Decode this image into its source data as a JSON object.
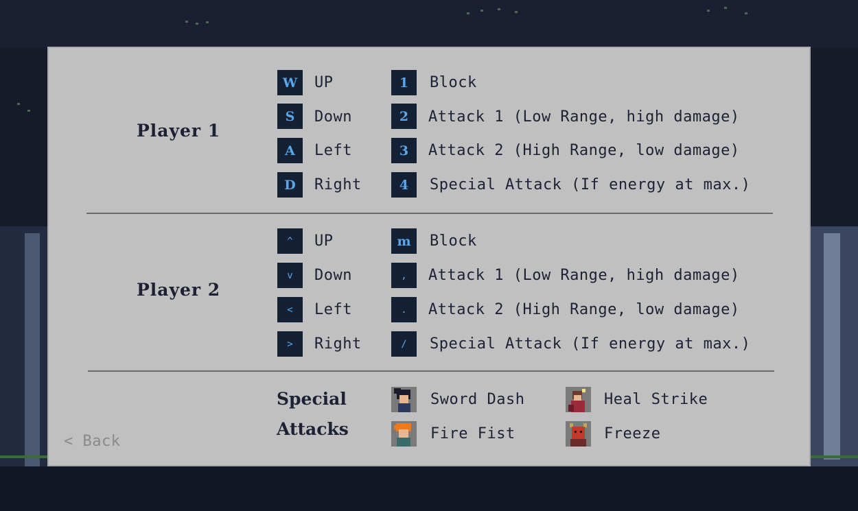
{
  "player1": {
    "title": "Player 1",
    "movement": [
      {
        "key": "W",
        "action": "UP"
      },
      {
        "key": "S",
        "action": "Down"
      },
      {
        "key": "A",
        "action": "Left"
      },
      {
        "key": "D",
        "action": "Right"
      }
    ],
    "combat": [
      {
        "key": "1",
        "action": "Block"
      },
      {
        "key": "2",
        "action": "Attack 1 (Low Range, high damage)"
      },
      {
        "key": "3",
        "action": "Attack 2 (High Range, low damage)"
      },
      {
        "key": "4",
        "action": "Special Attack (If energy at max.)"
      }
    ]
  },
  "player2": {
    "title": "Player 2",
    "movement": [
      {
        "key": "^",
        "action": "UP"
      },
      {
        "key": "v",
        "action": "Down"
      },
      {
        "key": "<",
        "action": "Left"
      },
      {
        "key": ">",
        "action": "Right"
      }
    ],
    "combat": [
      {
        "key": "m",
        "action": "Block"
      },
      {
        "key": ",",
        "action": "Attack 1 (Low Range, high damage)"
      },
      {
        "key": ".",
        "action": "Attack 2 (High Range, low damage)"
      },
      {
        "key": "/",
        "action": "Special Attack (If energy at max.)"
      }
    ]
  },
  "special": {
    "title_line1": "Special",
    "title_line2": "Attacks",
    "attacks": [
      {
        "name": "Sword Dash",
        "icon": "samurai-portrait-icon"
      },
      {
        "name": "Heal Strike",
        "icon": "monk-portrait-icon"
      },
      {
        "name": "Fire Fist",
        "icon": "orange-hair-fighter-portrait-icon"
      },
      {
        "name": "Freeze",
        "icon": "red-demon-portrait-icon"
      }
    ]
  },
  "nav": {
    "back_label": "< Back"
  },
  "colors": {
    "panel": "#c0c0c0",
    "key_bg": "#142034",
    "key_text": "#5aa6e8",
    "text": "#1c2233",
    "background": "#161b2a"
  }
}
